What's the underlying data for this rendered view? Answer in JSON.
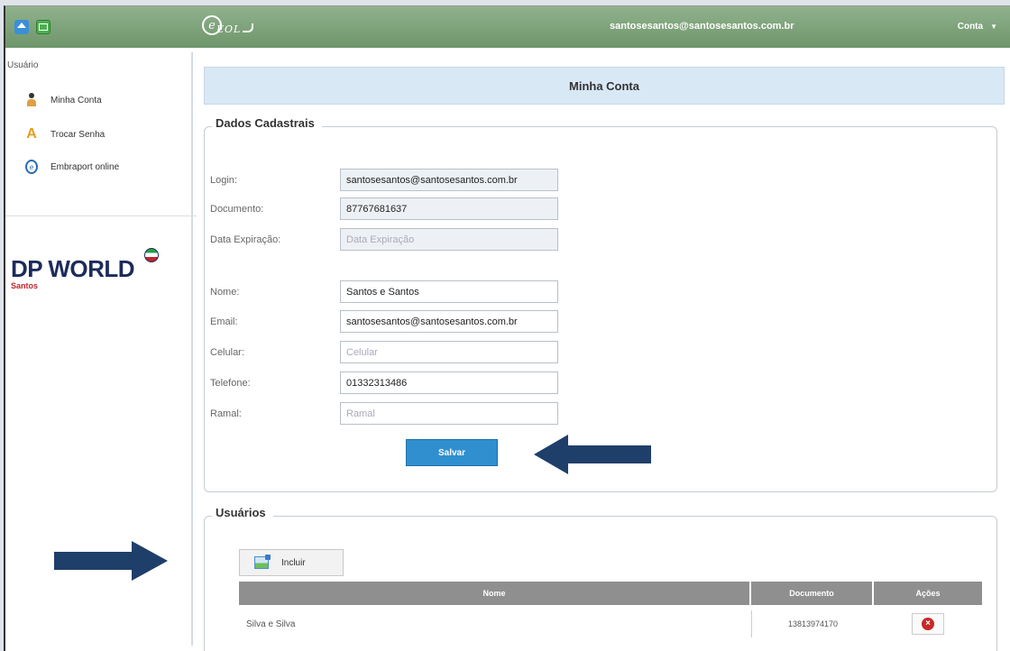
{
  "topbar": {
    "logo": "EOL",
    "logo_mark": "e",
    "user_email": "santosesantos@santosesantos.com.br",
    "account_label": "Conta",
    "account_caret": "▼",
    "icons": [
      "home-icon",
      "spreadsheet-icon"
    ]
  },
  "sidebar": {
    "section_title": "Usuário",
    "items": [
      {
        "label": "Minha Conta",
        "icon": "person-icon"
      },
      {
        "label": "Trocar Senha",
        "icon": "key-icon"
      },
      {
        "label": "Embraport online",
        "icon": "eol-icon"
      }
    ],
    "brand": {
      "name": "DP WORLD",
      "subtitle": "Santos"
    }
  },
  "page": {
    "title": "Minha Conta"
  },
  "dados_cadastrais": {
    "legend": "Dados Cadastrais",
    "fields": [
      {
        "label": "Login:",
        "value": "santosesantos@santosesantos.com.br",
        "placeholder": "",
        "readonly": true
      },
      {
        "label": "Documento:",
        "value": "87767681637",
        "placeholder": "",
        "readonly": true
      },
      {
        "label": "Data Expiração:",
        "value": "",
        "placeholder": "Data Expiração",
        "readonly": true
      },
      {
        "label": "Nome:",
        "value": "Santos e Santos",
        "placeholder": "",
        "readonly": false
      },
      {
        "label": "Email:",
        "value": "santosesantos@santosesantos.com.br",
        "placeholder": "",
        "readonly": false
      },
      {
        "label": "Celular:",
        "value": "",
        "placeholder": "Celular",
        "readonly": false
      },
      {
        "label": "Telefone:",
        "value": "01332313486",
        "placeholder": "",
        "readonly": false
      },
      {
        "label": "Ramal:",
        "value": "",
        "placeholder": "Ramal",
        "readonly": false
      }
    ],
    "save_label": "Salvar"
  },
  "usuarios": {
    "legend": "Usuários",
    "add_label": "Incluir",
    "columns": [
      "Nome",
      "Documento",
      "Ações"
    ],
    "rows": [
      {
        "nome": "Silva e Silva",
        "documento": "13813974170"
      }
    ]
  },
  "colors": {
    "topbar": "#7fa57b",
    "header_bg": "#d9e8f5",
    "save_button": "#2f8fcf",
    "arrow": "#1f3f6b",
    "table_header": "#8f8f8f",
    "delete": "#c62828"
  }
}
